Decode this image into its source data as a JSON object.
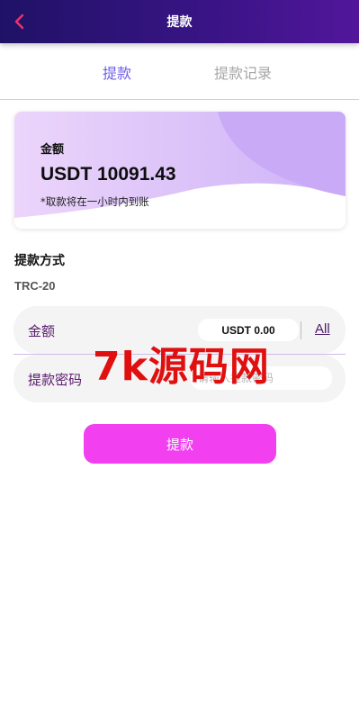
{
  "header": {
    "title": "提款",
    "back_icon": "chevron-left-icon",
    "back_color": "#e8356f",
    "background": "#2a147a"
  },
  "tabs": [
    {
      "label": "提款",
      "active": true
    },
    {
      "label": "提款记录",
      "active": false
    }
  ],
  "balance": {
    "label": "金额",
    "amount": "USDT 10091.43",
    "note": "*取款将在一小时内到账"
  },
  "method": {
    "title": "提款方式",
    "value": "TRC-20"
  },
  "form": {
    "amount_label": "金额",
    "amount_value": "USDT 0.00",
    "all_label": "All",
    "password_label": "提款密码",
    "password_placeholder": "请输入提款密码"
  },
  "submit_label": "提款",
  "watermark": "7k源码网",
  "colors": {
    "accent_tab": "#6f5fe6",
    "submit": "#f23ff0",
    "watermark": "#e01010"
  }
}
